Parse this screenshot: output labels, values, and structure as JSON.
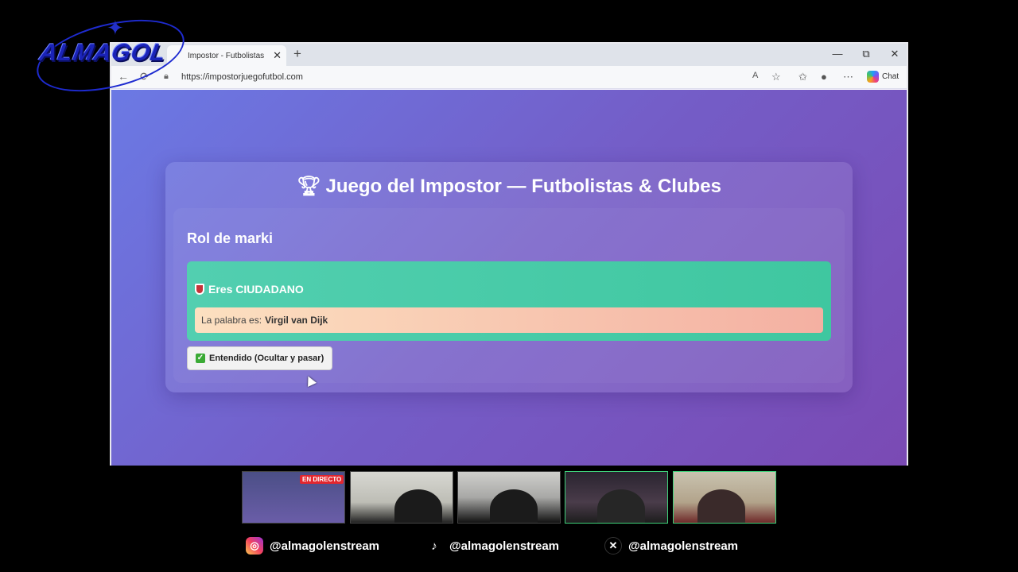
{
  "browser": {
    "tab_title": "Impostor - Futbolistas y",
    "tab_close": "✕",
    "new_tab": "+",
    "url": "https://impostorjuegofutbol.com",
    "chat_label": "Chat",
    "window_controls": {
      "minimize": "—",
      "restore": "⧉",
      "close": "✕"
    }
  },
  "page": {
    "title": "Juego del Impostor — Futbolistas & Clubes",
    "role_heading": "Rol de marki",
    "role_label": "Eres CIUDADANO",
    "word_prefix": "La palabra es:",
    "word_value": "Virgil van Dijk",
    "confirm_button": "Entendido (Ocultar y pasar)"
  },
  "overlay": {
    "logo": "ALMAGOL",
    "live_badge": "EN DIRECTO",
    "socials": [
      {
        "network": "instagram",
        "handle": "@almagolenstream"
      },
      {
        "network": "tiktok",
        "handle": "@almagolenstream"
      },
      {
        "network": "x",
        "handle": "@almagolenstream"
      }
    ]
  },
  "colors": {
    "page_gradient_start": "#6b79e4",
    "page_gradient_end": "#7a4ab4",
    "role_box": "#4ccca9",
    "word_box_start": "#fce0c0",
    "word_box_end": "#f4b0a2"
  }
}
